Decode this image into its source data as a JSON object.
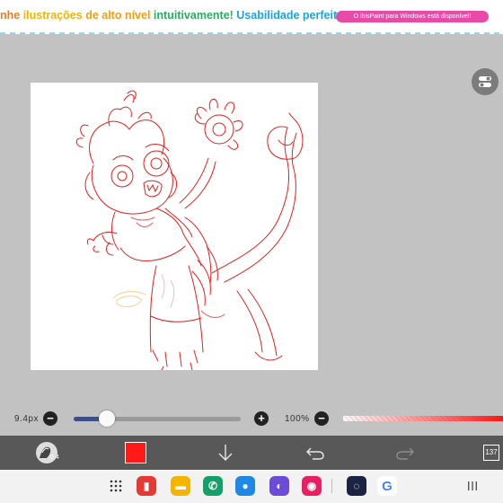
{
  "banner": {
    "segments": [
      {
        "text": "nhe ",
        "color": "#e67e22"
      },
      {
        "text": "ilustrações ",
        "color": "#f0b400"
      },
      {
        "text": "de alto nível ",
        "color": "#f39c12"
      },
      {
        "text": "intuitivamente! ",
        "color": "#27ae60"
      },
      {
        "text": "Usabilidade perfeita!",
        "color": "#1aa3e0"
      }
    ],
    "windows_notice": "O ibisPaint para Windows está disponível!"
  },
  "brush": {
    "size_label": "9.4px",
    "size_fraction": 0.2,
    "decrease_label": "−",
    "increase_label": "+"
  },
  "opacity": {
    "label": "100%",
    "decrease_label": "−",
    "value_percent": 100
  },
  "toolbar": {
    "brush_badge": "0.4",
    "current_color": "#ff1a1a",
    "layer_count": "137"
  },
  "canvas": {
    "background": "#ffffff",
    "sketch_color": "#e02020"
  },
  "navbar": {
    "apps": [
      {
        "name": "samsung-notes-icon",
        "color": "#e53935",
        "glyph": "▮"
      },
      {
        "name": "my-files-icon",
        "color": "#f4b400",
        "glyph": "▬"
      },
      {
        "name": "phone-icon",
        "color": "#14a06a",
        "glyph": "✆"
      },
      {
        "name": "messages-icon",
        "color": "#1e88e5",
        "glyph": "●"
      },
      {
        "name": "internet-icon",
        "color": "#6c4bd8",
        "glyph": "◐"
      },
      {
        "name": "camera-icon",
        "color": "#e91e63",
        "glyph": "◉"
      },
      {
        "name": "ibispaint-icon",
        "color": "#1b2440",
        "glyph": "◌"
      },
      {
        "name": "google-icon",
        "color": "#ffffff",
        "glyph": "G"
      }
    ]
  }
}
